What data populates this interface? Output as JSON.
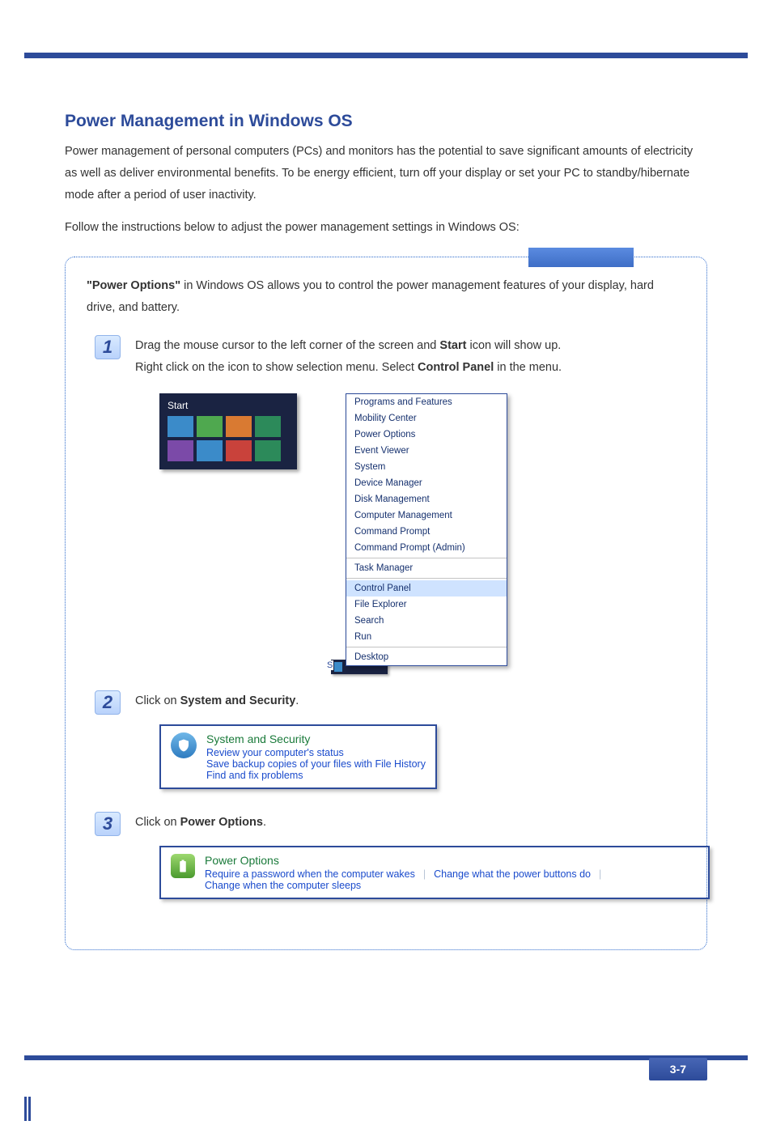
{
  "header": {
    "section_title": "Power Management in Windows OS",
    "intro_para": "Power management of personal computers (PCs) and monitors has the potential to save significant amounts of electricity as well as deliver environmental benefits. To be energy efficient, turn off your display or set your PC to standby/hibernate mode after a period of user inactivity.",
    "follow_line": "Follow the instructions below to adjust the power management settings in Windows OS:"
  },
  "box_intro": {
    "prefix_bold": "\"Power Options\"",
    "rest": " in Windows OS allows you to control the power management features of your display, hard drive, and battery."
  },
  "steps": {
    "s1": {
      "num": "1",
      "line1_a": "Drag the mouse cursor to the left corner of the screen and ",
      "line1_b": "Start",
      "line1_c": " icon will show up.",
      "line2_a": "Right click on the icon to show selection menu.   Select ",
      "line2_b": "Control Panel",
      "line2_c": " in the menu."
    },
    "s2": {
      "num": "2",
      "pre": "Click on ",
      "bold": "System and Security",
      "post": "."
    },
    "s3": {
      "num": "3",
      "pre": "Click on ",
      "bold": "Power Options",
      "post": "."
    }
  },
  "start_tile_label": "Start",
  "context_menu": {
    "items_top": [
      "Programs and Features",
      "Mobility Center",
      "Power Options",
      "Event Viewer",
      "System",
      "Device Manager",
      "Disk Management",
      "Computer Management",
      "Command Prompt",
      "Command Prompt (Admin)"
    ],
    "group2": [
      "Task Manager"
    ],
    "highlighted": "Control Panel",
    "group3": [
      "File Explorer",
      "Search",
      "Run"
    ],
    "group4": [
      "Desktop"
    ]
  },
  "sys_panel": {
    "title": "System and Security",
    "l1": "Review your computer's status",
    "l2": "Save backup copies of your files with File History",
    "l3": "Find and fix problems"
  },
  "pwr_panel": {
    "title": "Power Options",
    "l1": "Require a password when the computer wakes",
    "l2": "Change what the power buttons do",
    "l3": "Change when the computer sleeps"
  },
  "page_number": "3-7",
  "strip_s": "S"
}
